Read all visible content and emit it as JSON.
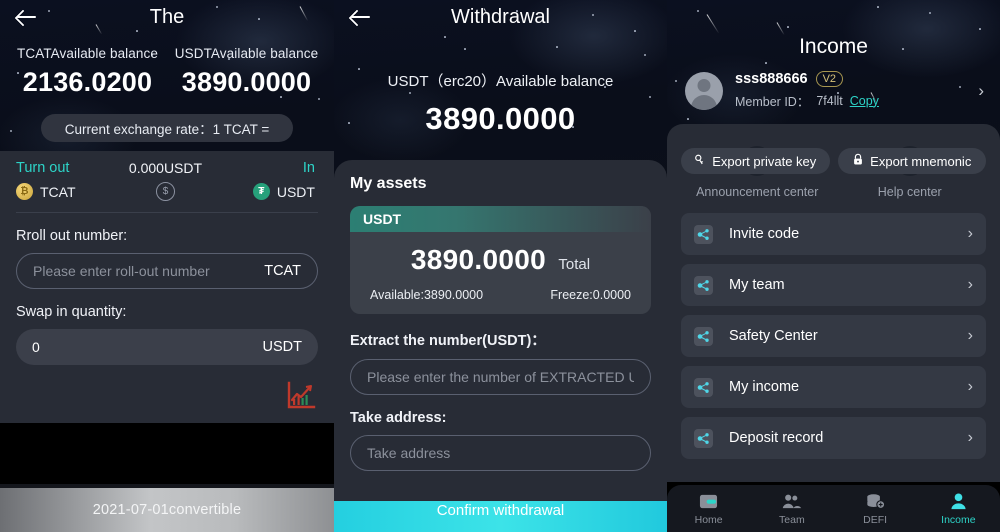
{
  "panel1": {
    "title": "The",
    "back_icon": "back-arrow-icon",
    "balances": [
      {
        "label": "TCATAvailable balance",
        "value": "2136.0200"
      },
      {
        "label": "USDTAvailable balance",
        "value": "3890.0000"
      }
    ],
    "rate_pill": "Current exchange rate：1 TCAT =",
    "swap": {
      "out_label": "Turn out",
      "out_coin": "TCAT",
      "amount": "0.000USDT",
      "in_label": "In",
      "in_coin": "USDT",
      "swap_icon": "swap-circle-icon"
    },
    "rollout": {
      "label": "Rroll out number:",
      "placeholder": "Please enter roll-out number",
      "value": "",
      "suffix": "TCAT"
    },
    "swapin": {
      "label": "Swap in quantity:",
      "value": "0",
      "placeholder": "0",
      "suffix": "USDT"
    },
    "chart_icon": "trend-chart-icon",
    "bottom_button": "2021-07-01convertible"
  },
  "panel2": {
    "title": "Withdrawal",
    "back_icon": "back-arrow-icon",
    "balance_caption": "USDT（erc20）Available balance",
    "balance_value": "3890.0000",
    "assets_title": "My assets",
    "asset_card": {
      "symbol": "USDT",
      "total_value": "3890.0000",
      "total_label": "Total",
      "available": "Available:3890.0000",
      "freeze": "Freeze:0.0000"
    },
    "extract": {
      "label": "Extract the number(USDT)：",
      "placeholder": "Please enter the number of EXTRACTED USDT",
      "value": ""
    },
    "address": {
      "label": "Take address:",
      "placeholder": "Take address",
      "value": ""
    },
    "confirm_button": "Confirm withdrawal"
  },
  "panel3": {
    "title": "Income",
    "user": {
      "name": "sss888666",
      "badge": "V2",
      "member_id_label": "Member ID：",
      "member_id": "7f4llt",
      "copy": "Copy",
      "chevron": "›"
    },
    "export_buttons": [
      {
        "label": "Export private key",
        "icon": "key-icon"
      },
      {
        "label": "Export mnemonic",
        "icon": "lock-icon"
      }
    ],
    "centers": [
      {
        "label": "Announcement center",
        "icon": "location-pin-icon"
      },
      {
        "label": "Help center",
        "icon": "info-icon"
      }
    ],
    "menu": [
      {
        "label": "Invite code",
        "icon": "share-nodes-icon",
        "chevron": "›"
      },
      {
        "label": "My team",
        "icon": "share-nodes-icon",
        "chevron": "›"
      },
      {
        "label": "Safety Center",
        "icon": "share-nodes-icon",
        "chevron": "›"
      },
      {
        "label": "My income",
        "icon": "share-nodes-icon",
        "chevron": "›"
      },
      {
        "label": "Deposit record",
        "icon": "share-nodes-icon",
        "chevron": "›"
      }
    ],
    "nav": [
      {
        "label": "Home",
        "icon": "wallet-icon",
        "active": false
      },
      {
        "label": "Team",
        "icon": "people-icon",
        "active": false
      },
      {
        "label": "DEFI",
        "icon": "coins-stack-icon",
        "active": false
      },
      {
        "label": "Income",
        "icon": "person-icon",
        "active": true
      }
    ]
  },
  "colors": {
    "accent_teal": "#2dd4c8",
    "panel_bg": "#282c36",
    "card_bg": "#343944",
    "confirm_gradient_start": "#24cfe0",
    "badge_gold": "#d6c27a",
    "chart_red": "#c0392b"
  }
}
